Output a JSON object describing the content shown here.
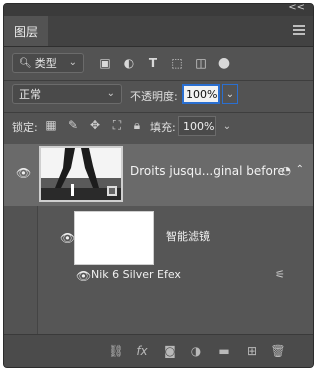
{
  "panel": {
    "collapse_glyph": "<<",
    "tab_label": "图层",
    "menu_icon": "hamburger-icon"
  },
  "filter_row": {
    "kind_select": "类型",
    "icons": [
      "image-filter-icon",
      "adjustment-filter-icon",
      "type-filter-icon",
      "shape-filter-icon",
      "smart-object-filter-icon",
      "filter-toggle-icon"
    ]
  },
  "blend_row": {
    "mode": "正常",
    "opacity_label": "不透明度:",
    "opacity_value": "100%"
  },
  "lock_row": {
    "lock_label": "锁定:",
    "lock_icons": [
      "lock-transparent-icon",
      "lock-image-icon",
      "lock-position-icon",
      "lock-artboard-icon",
      "lock-all-icon"
    ],
    "fill_label": "填充:",
    "fill_value": "100%"
  },
  "layers": [
    {
      "name": "Droits jusqu...ginal before",
      "visible": true,
      "smart_object": true
    }
  ],
  "smart_filter": {
    "label": "智能滤镜",
    "visible": true,
    "effects": [
      {
        "name": "Nik 6 Silver Efex",
        "visible": true
      }
    ]
  },
  "bottom_bar": {
    "icons": [
      "link-layers-icon",
      "fx-icon",
      "add-mask-icon",
      "adjustment-layer-icon",
      "new-group-icon",
      "new-layer-icon",
      "delete-icon"
    ],
    "fx_label": "fx"
  },
  "colors": {
    "panel_bg": "#535353",
    "selected_layer_bg": "#6a6a6a",
    "focus_blue": "#2a6fd1"
  }
}
